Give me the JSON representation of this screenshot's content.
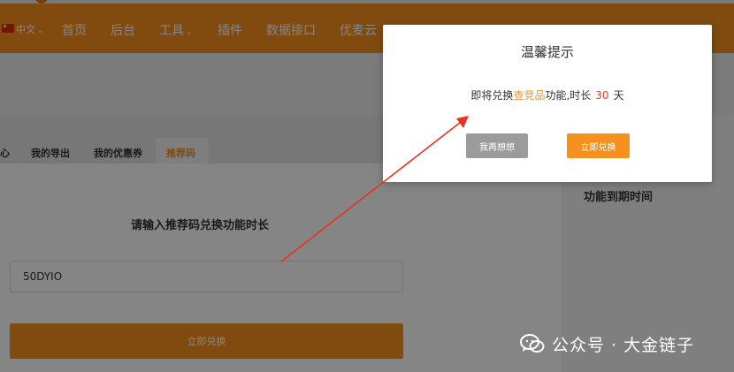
{
  "navbar": {
    "language": "中文",
    "items": [
      "首页",
      "后台",
      "工具",
      "插件",
      "数据接口",
      "优麦云"
    ]
  },
  "tabs": [
    "心",
    "我的导出",
    "我的优惠券",
    "推荐码"
  ],
  "form": {
    "title": "请输入推荐码兑换功能时长",
    "code_value": "50DYIO",
    "submit_label": "立即兑换"
  },
  "side_panel": {
    "title": "功能到期时间"
  },
  "modal": {
    "title": "温馨提示",
    "msg_prefix": "即将兑换",
    "product": "查竞品",
    "msg_middle": "功能,时长",
    "days": "30",
    "msg_suffix": "天",
    "cancel_label": "我再想想",
    "confirm_label": "立即兑换"
  },
  "watermark": {
    "text": "公众号 · 大金链子"
  },
  "colors": {
    "accent": "#f7911d",
    "annotation_arrow": "#e8321e",
    "days_highlight": "#e0412f"
  }
}
